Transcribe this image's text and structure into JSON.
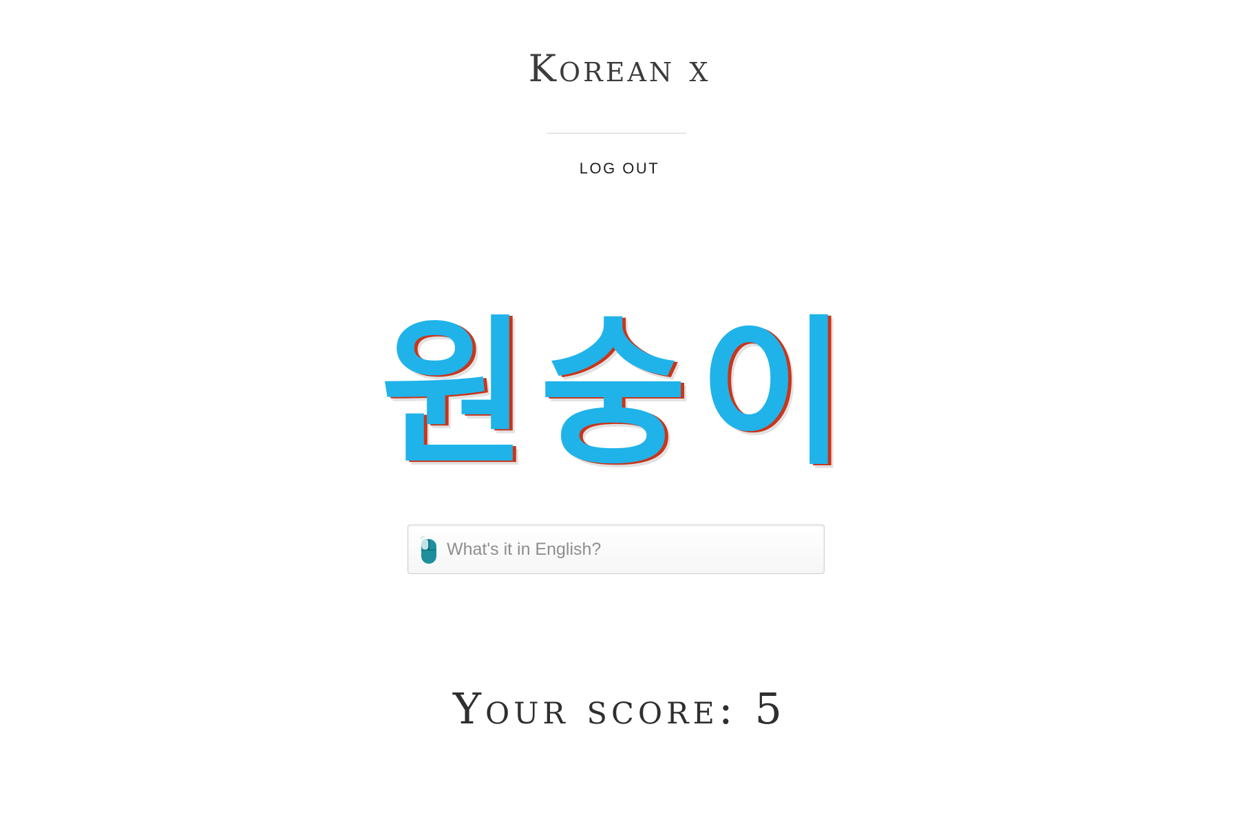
{
  "header": {
    "title": "Korean x",
    "logout_label": "LOG OUT"
  },
  "quiz": {
    "korean_word": "원숭이",
    "input_placeholder": "What's it in English?",
    "input_value": ""
  },
  "score": {
    "label": "Your score:",
    "value": "5"
  },
  "colors": {
    "word_fill": "#1fb3ea",
    "word_outline": "#c9361a",
    "word_shadow": "#e2e2e2",
    "mouse_icon": "#1e8f9c"
  },
  "icons": {
    "input_icon": "mouse-icon"
  }
}
